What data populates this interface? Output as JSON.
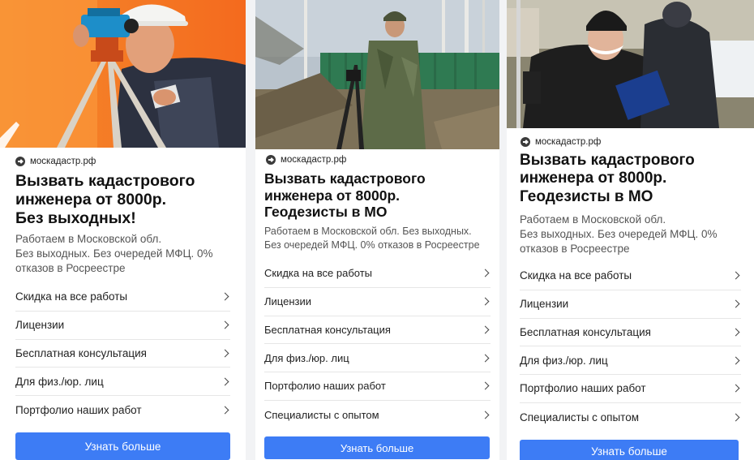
{
  "cards": [
    {
      "domain": "москадастр.рф",
      "headline": "Вызвать кадастрового\nинженера от 8000р.\nБез выходных!",
      "description": "Работаем в Московской обл.\nБез выходных. Без очередей МФЦ. 0%\nотказов в Росреестре",
      "links": [
        "Скидка на все работы",
        "Лицензии",
        "Бесплатная консультация",
        "Для физ./юр. лиц",
        "Портфолио наших работ"
      ],
      "cta": "Узнать больше"
    },
    {
      "domain": "москадастр.рф",
      "headline": "Вызвать кадастрового\nинженера от 8000р.\nГеодезисты в МО",
      "description": "Работаем в Московской обл. Без выходных.\nБез очередей МФЦ. 0% отказов в Росреестре",
      "links": [
        "Скидка на все работы",
        "Лицензии",
        "Бесплатная консультация",
        "Для физ./юр. лиц",
        "Портфолио наших работ",
        "Специалисты с опытом"
      ],
      "cta": "Узнать больше"
    },
    {
      "domain": "москадастр.рф",
      "headline": "Вызвать кадастрового\nинженера от 8000р.\nГеодезисты в МО",
      "description": "Работаем в Московской обл.\nБез выходных. Без очередей МФЦ. 0%\nотказов в Росреестре",
      "links": [
        "Скидка на все работы",
        "Лицензии",
        "Бесплатная консультация",
        "Для физ./юр. лиц",
        "Портфолио наших работ",
        "Специалисты с опытом"
      ],
      "cta": "Узнать больше"
    }
  ],
  "colors": {
    "cta_background": "#3d7cf5",
    "page_background": "#f2f3f5"
  },
  "icons": {
    "domain": "arrow-circle-icon",
    "link": "chevron-right-icon"
  }
}
